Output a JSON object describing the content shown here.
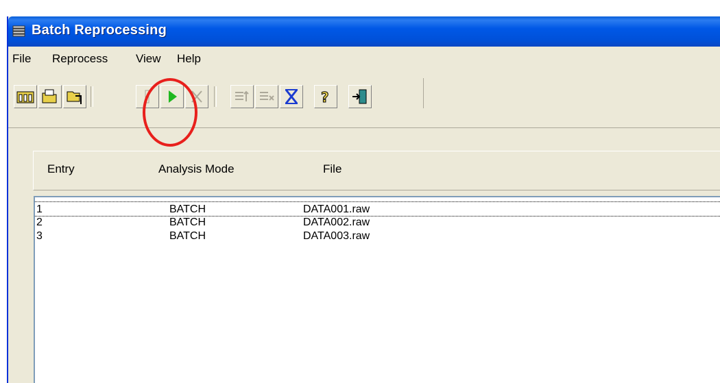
{
  "window": {
    "title": "Batch Reprocessing"
  },
  "menu": [
    "File",
    "Reprocess",
    "View",
    "Help"
  ],
  "toolbar": {
    "buttons": [
      "new-batch",
      "open-batch",
      "save-batch",
      "pause",
      "start",
      "stop",
      "move-up",
      "delete-entry",
      "clear-all",
      "help",
      "exit"
    ]
  },
  "list": {
    "columns": [
      "Entry",
      "Analysis Mode",
      "File"
    ],
    "rows": [
      {
        "entry": "1",
        "mode": "BATCH",
        "file": "DATA001.raw"
      },
      {
        "entry": "2",
        "mode": "BATCH",
        "file": "DATA002.raw"
      },
      {
        "entry": "3",
        "mode": "BATCH",
        "file": "DATA003.raw"
      }
    ]
  },
  "colors": {
    "titlebar": "#0058e6",
    "highlight": "#e8201c",
    "start": "#1fb81f"
  }
}
